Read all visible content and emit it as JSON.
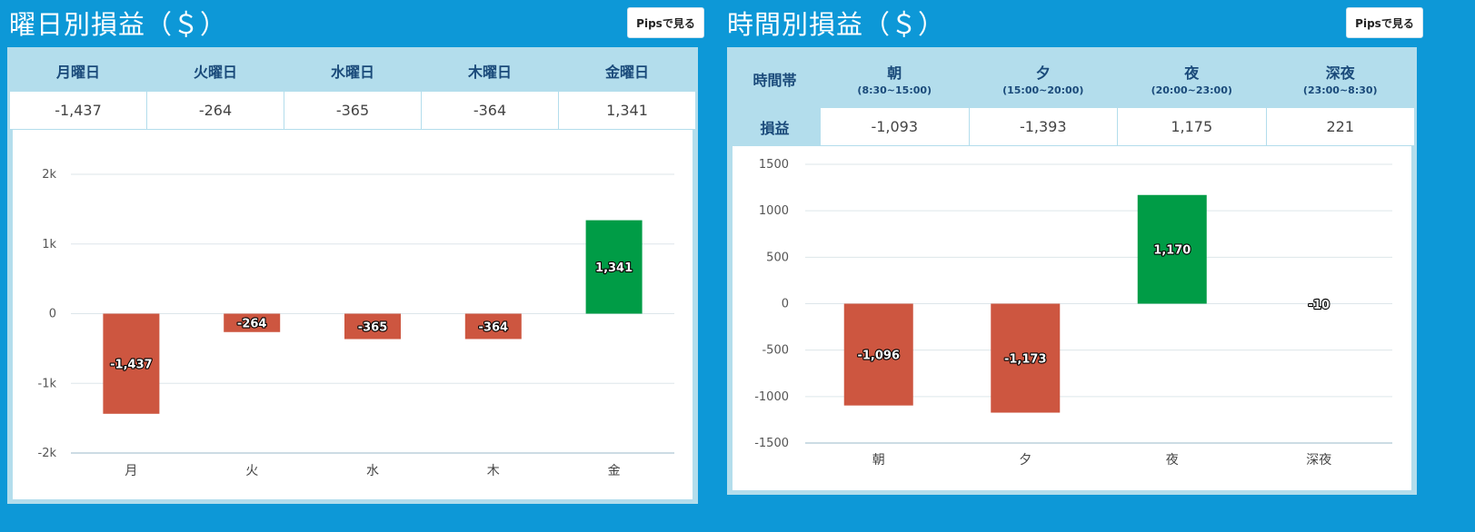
{
  "left_panel": {
    "title": "曜日別損益（＄）",
    "pips_button": "Pipsで見る",
    "headers": [
      "月曜日",
      "火曜日",
      "水曜日",
      "木曜日",
      "金曜日"
    ],
    "values": [
      "-1,437",
      "-264",
      "-365",
      "-364",
      "1,341"
    ]
  },
  "right_panel": {
    "title": "時間別損益（＄）",
    "pips_button": "Pipsで見る",
    "row_header_1": "時間帯",
    "row_header_2": "損益",
    "headers": [
      {
        "label": "朝",
        "sub": "(8:30~15:00)"
      },
      {
        "label": "夕",
        "sub": "(15:00~20:00)"
      },
      {
        "label": "夜",
        "sub": "(20:00~23:00)"
      },
      {
        "label": "深夜",
        "sub": "(23:00~8:30)"
      }
    ],
    "values": [
      "-1,093",
      "-1,393",
      "1,175",
      "221"
    ]
  },
  "chart_data": [
    {
      "type": "bar",
      "categories": [
        "月",
        "火",
        "水",
        "木",
        "金"
      ],
      "values": [
        -1437,
        -264,
        -365,
        -364,
        1341
      ],
      "data_labels": [
        "-1,437",
        "-264",
        "-365",
        "-364",
        "1,341"
      ],
      "ylim": [
        -2000,
        2000
      ],
      "yticks": [
        2000,
        1000,
        0,
        -1000,
        -2000
      ],
      "ytick_labels": [
        "2k",
        "1k",
        "0",
        "-1k",
        "-2k"
      ],
      "grid": true,
      "colors": {
        "positive": "#009c46",
        "negative": "#cd5640"
      }
    },
    {
      "type": "bar",
      "categories": [
        "朝",
        "夕",
        "夜",
        "深夜"
      ],
      "values": [
        -1096,
        -1173,
        1170,
        -10
      ],
      "data_labels": [
        "-1,096",
        "-1,173",
        "1,170",
        "-10"
      ],
      "ylim": [
        -1500,
        1500
      ],
      "yticks": [
        1500,
        1000,
        500,
        0,
        -500,
        -1000,
        -1500
      ],
      "ytick_labels": [
        "1500",
        "1000",
        "500",
        "0",
        "-500",
        "-1000",
        "-1500"
      ],
      "grid": true,
      "colors": {
        "positive": "#009c46",
        "negative": "#cd5640"
      }
    }
  ]
}
